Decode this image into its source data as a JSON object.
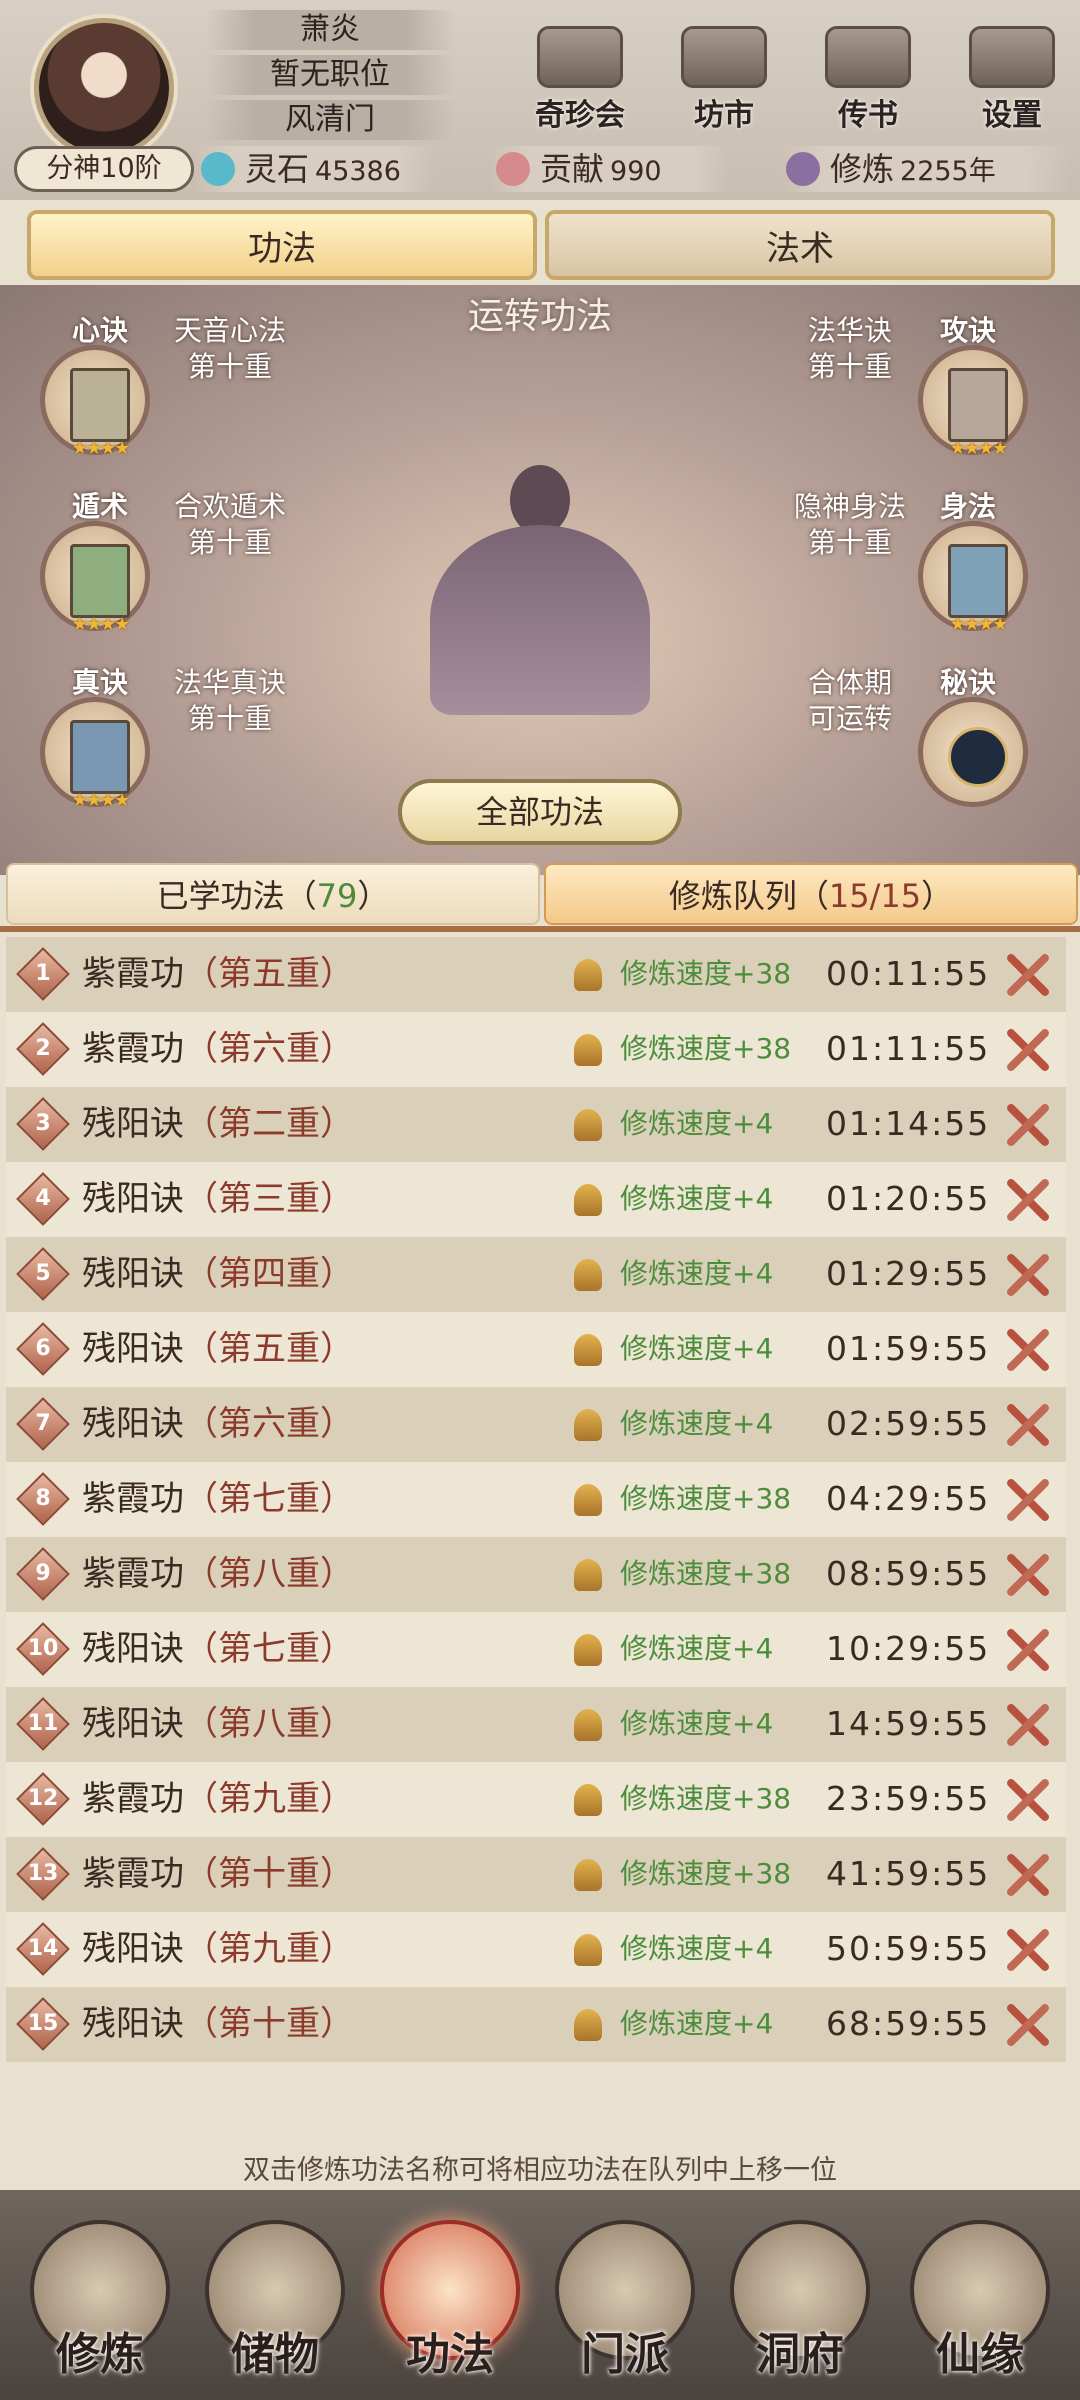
{
  "header": {
    "name": "萧炎",
    "position": "暂无职位",
    "sect": "风清门",
    "rank": "分神10阶",
    "buttons": [
      {
        "label": "奇珍会",
        "icon": "treasure-hall-icon"
      },
      {
        "label": "坊市",
        "icon": "market-icon"
      },
      {
        "label": "传书",
        "icon": "letter-icon"
      },
      {
        "label": "设置",
        "icon": "gear-icon"
      }
    ],
    "resources": [
      {
        "label": "灵石",
        "value": "45386",
        "icon": "spirit-stone-icon",
        "color": "#59b8c9"
      },
      {
        "label": "贡献",
        "value": "990",
        "icon": "contribution-icon",
        "color": "#d68a8c"
      },
      {
        "label": "修炼",
        "value": "2255年",
        "icon": "cultivation-icon",
        "color": "#8a6fa0"
      }
    ]
  },
  "tabs": {
    "gongfa": "功法",
    "fashu": "法术"
  },
  "stage": {
    "title": "运转功法",
    "all_button": "全部功法",
    "slots": [
      {
        "tag": "心诀",
        "name": "天音心法",
        "level": "第十重"
      },
      {
        "tag": "遁术",
        "name": "合欢遁术",
        "level": "第十重"
      },
      {
        "tag": "真诀",
        "name": "法华真诀",
        "level": "第十重"
      },
      {
        "tag": "攻诀",
        "name": "法华诀",
        "level": "第十重"
      },
      {
        "tag": "身法",
        "name": "隐神身法",
        "level": "第十重"
      },
      {
        "tag": "秘诀",
        "name": "合体期",
        "level": "可运转"
      }
    ]
  },
  "subtabs": {
    "learned_label": "已学功法（",
    "learned_count": "79",
    "learned_close": "）",
    "queue_label": "修炼队列（",
    "queue_count": "15/15",
    "queue_close": "）"
  },
  "queue": [
    {
      "idx": "1",
      "name": "紫霞功",
      "level": "第五重",
      "speed": "修炼速度+38",
      "time": "00:11:55"
    },
    {
      "idx": "2",
      "name": "紫霞功",
      "level": "第六重",
      "speed": "修炼速度+38",
      "time": "01:11:55"
    },
    {
      "idx": "3",
      "name": "残阳诀",
      "level": "第二重",
      "speed": "修炼速度+4",
      "time": "01:14:55"
    },
    {
      "idx": "4",
      "name": "残阳诀",
      "level": "第三重",
      "speed": "修炼速度+4",
      "time": "01:20:55"
    },
    {
      "idx": "5",
      "name": "残阳诀",
      "level": "第四重",
      "speed": "修炼速度+4",
      "time": "01:29:55"
    },
    {
      "idx": "6",
      "name": "残阳诀",
      "level": "第五重",
      "speed": "修炼速度+4",
      "time": "01:59:55"
    },
    {
      "idx": "7",
      "name": "残阳诀",
      "level": "第六重",
      "speed": "修炼速度+4",
      "time": "02:59:55"
    },
    {
      "idx": "8",
      "name": "紫霞功",
      "level": "第七重",
      "speed": "修炼速度+38",
      "time": "04:29:55"
    },
    {
      "idx": "9",
      "name": "紫霞功",
      "level": "第八重",
      "speed": "修炼速度+38",
      "time": "08:59:55"
    },
    {
      "idx": "10",
      "name": "残阳诀",
      "level": "第七重",
      "speed": "修炼速度+4",
      "time": "10:29:55"
    },
    {
      "idx": "11",
      "name": "残阳诀",
      "level": "第八重",
      "speed": "修炼速度+4",
      "time": "14:59:55"
    },
    {
      "idx": "12",
      "name": "紫霞功",
      "level": "第九重",
      "speed": "修炼速度+38",
      "time": "23:59:55"
    },
    {
      "idx": "13",
      "name": "紫霞功",
      "level": "第十重",
      "speed": "修炼速度+38",
      "time": "41:59:55"
    },
    {
      "idx": "14",
      "name": "残阳诀",
      "level": "第九重",
      "speed": "修炼速度+4",
      "time": "50:59:55"
    },
    {
      "idx": "15",
      "name": "残阳诀",
      "level": "第十重",
      "speed": "修炼速度+4",
      "time": "68:59:55"
    }
  ],
  "hint": "双击修炼功法名称可将相应功法在队列中上移一位",
  "nav": [
    {
      "label": "修炼",
      "icon": "cultivate-icon"
    },
    {
      "label": "储物",
      "icon": "storage-bag-icon"
    },
    {
      "label": "功法",
      "icon": "scroll-icon",
      "active": true
    },
    {
      "label": "门派",
      "icon": "sect-gate-icon"
    },
    {
      "label": "洞府",
      "icon": "cave-icon"
    },
    {
      "label": "仙缘",
      "icon": "fortune-icon"
    }
  ]
}
